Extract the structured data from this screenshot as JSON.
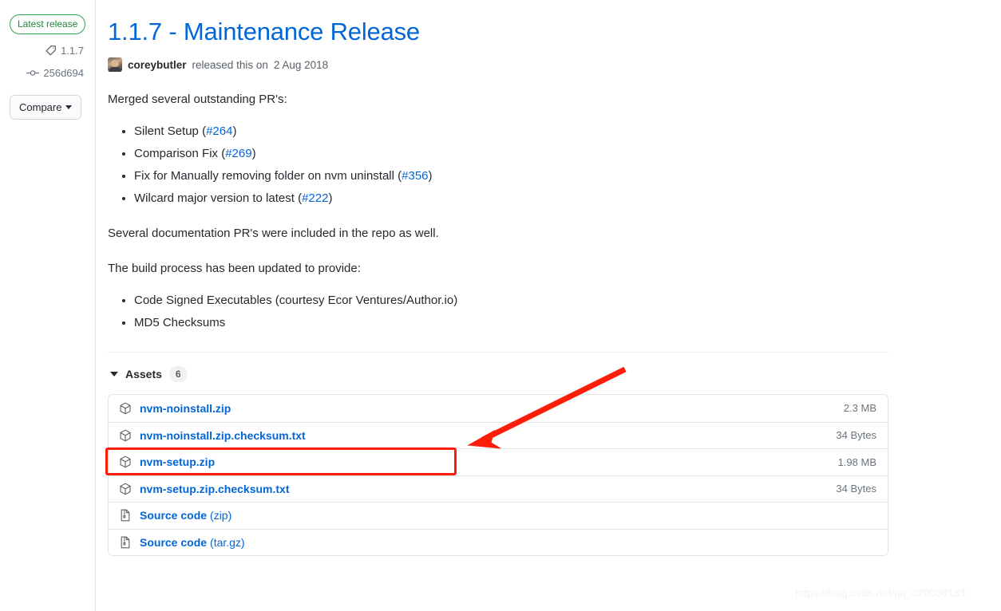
{
  "sidebar": {
    "latest_badge": "Latest release",
    "tag_icon": "tag-icon",
    "tag_name": "1.1.7",
    "commit_icon": "commit-icon",
    "commit_sha": "256d694",
    "compare_label": "Compare",
    "compare_caret_icon": "chevron-down-icon"
  },
  "release": {
    "title": "1.1.7 - Maintenance Release",
    "avatar_icon": "user-avatar",
    "author": "coreybutler",
    "byline_middle": "released this on",
    "date": "2 Aug 2018"
  },
  "body": {
    "intro": "Merged several outstanding PR's:",
    "pr_list": [
      {
        "text": "Silent Setup ",
        "open_paren": "(",
        "link": "#264",
        "close_paren": ")"
      },
      {
        "text": "Comparison Fix ",
        "open_paren": "(",
        "link": "#269",
        "close_paren": ")"
      },
      {
        "text": "Fix for Manually removing folder on nvm uninstall ",
        "open_paren": "(",
        "link": "#356",
        "close_paren": ")"
      },
      {
        "text": "Wilcard major version to latest ",
        "open_paren": "(",
        "link": "#222",
        "close_paren": ")"
      }
    ],
    "docs_note": "Several documentation PR's were included in the repo as well.",
    "build_intro": "The build process has been updated to provide:",
    "build_list": [
      "Code Signed Executables (courtesy Ecor Ventures/Author.io)",
      "MD5 Checksums"
    ]
  },
  "assets": {
    "caret_icon": "caret-down-icon",
    "label": "Assets",
    "count": "6",
    "rows": [
      {
        "icon": "package-icon",
        "name": "nvm-noinstall.zip",
        "suffix": "",
        "size": "2.3 MB"
      },
      {
        "icon": "package-icon",
        "name": "nvm-noinstall.zip.checksum.txt",
        "suffix": "",
        "size": "34 Bytes"
      },
      {
        "icon": "package-icon",
        "name": "nvm-setup.zip",
        "suffix": "",
        "size": "1.98 MB"
      },
      {
        "icon": "package-icon",
        "name": "nvm-setup.zip.checksum.txt",
        "suffix": "",
        "size": "34 Bytes"
      },
      {
        "icon": "file-zip-icon",
        "name": "Source code",
        "suffix": "(zip)",
        "size": ""
      },
      {
        "icon": "file-zip-icon",
        "name": "Source code",
        "suffix": "(tar.gz)",
        "size": ""
      }
    ]
  },
  "annotations": {
    "highlight_color": "#fd1d08",
    "arrow_color": "#fd1d08",
    "highlight_target": "nvm-setup.zip"
  },
  "watermark": {
    "text": "https://blog.csdn.net/qq_020030133"
  }
}
